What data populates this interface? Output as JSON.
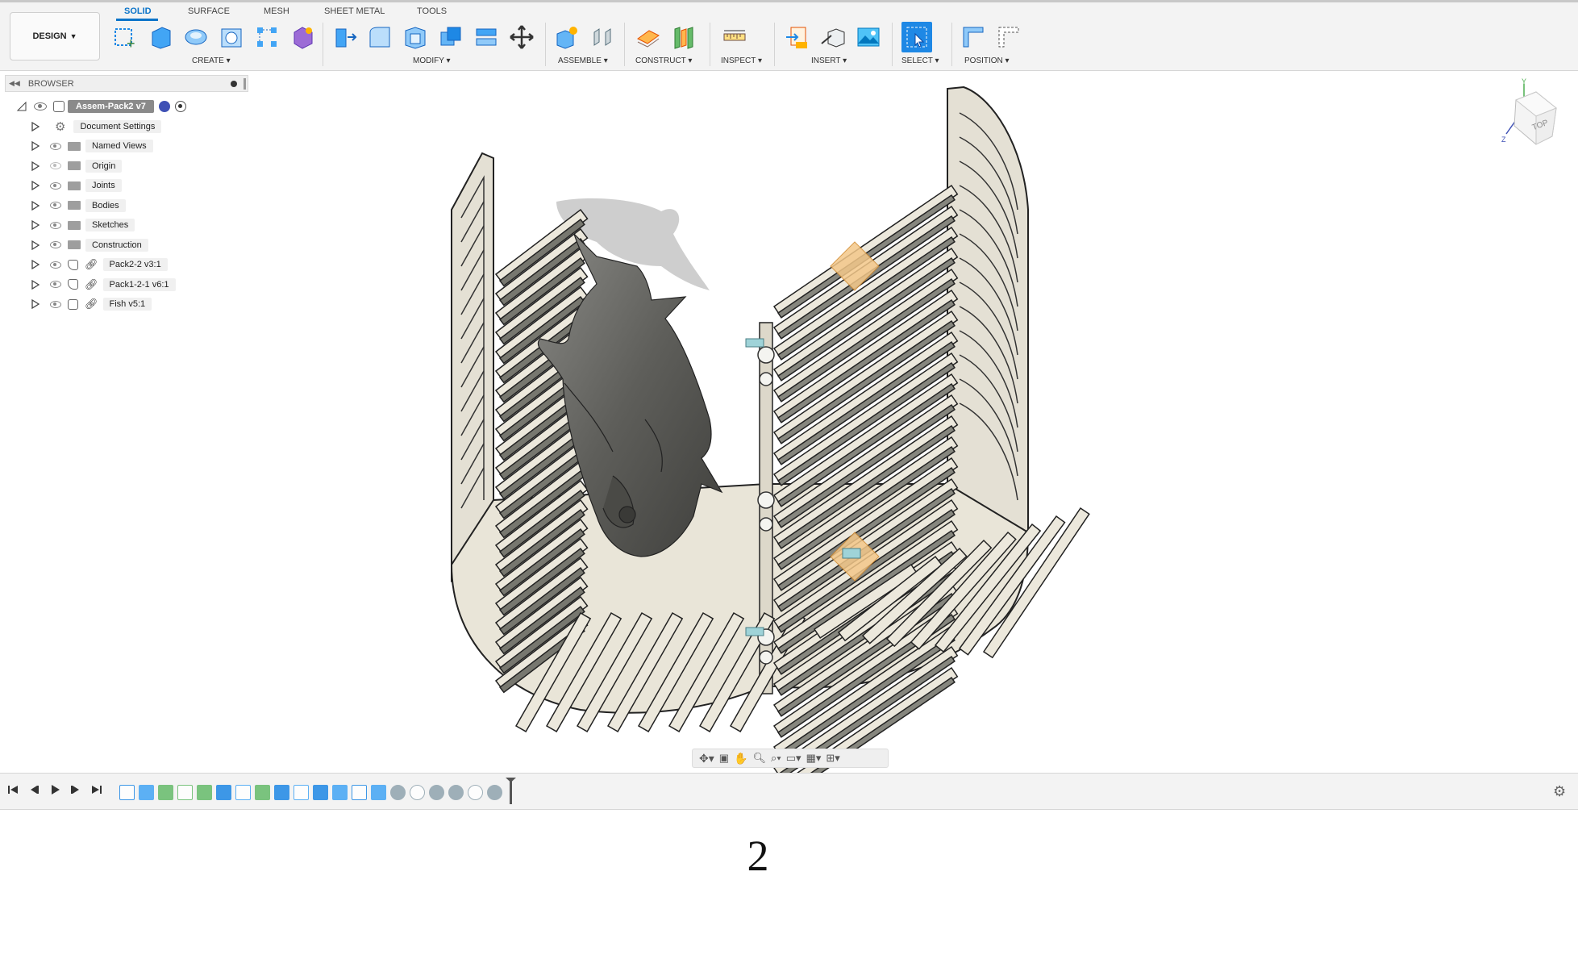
{
  "app": {
    "workspace_label": "DESIGN",
    "tabs": [
      {
        "label": "SOLID",
        "active": true
      },
      {
        "label": "SURFACE",
        "active": false
      },
      {
        "label": "MESH",
        "active": false
      },
      {
        "label": "SHEET METAL",
        "active": false
      },
      {
        "label": "TOOLS",
        "active": false
      }
    ],
    "accent_color": "#0b74c9"
  },
  "toolbar": {
    "groups": [
      {
        "label": "CREATE ▾",
        "icons": [
          "new-sketch-icon",
          "extrude-icon",
          "revolve-icon",
          "hole-icon",
          "pattern-icon",
          "create-form-icon"
        ]
      },
      {
        "label": "MODIFY ▾",
        "icons": [
          "press-pull-icon",
          "fillet-icon",
          "shell-icon",
          "combine-icon",
          "split-body-icon",
          "move-icon"
        ]
      },
      {
        "label": "ASSEMBLE ▾",
        "icons": [
          "new-component-icon",
          "joint-icon"
        ]
      },
      {
        "label": "CONSTRUCT ▾",
        "icons": [
          "offset-plane-icon",
          "midplane-icon"
        ]
      },
      {
        "label": "INSPECT ▾",
        "icons": [
          "measure-icon"
        ]
      },
      {
        "label": "INSERT ▾",
        "icons": [
          "insert-mesh-icon",
          "insert-derive-icon",
          "canvas-icon"
        ]
      },
      {
        "label": "SELECT ▾",
        "icons": [
          "select-icon"
        ]
      },
      {
        "label": "POSITION ▾",
        "icons": [
          "capture-position-icon",
          "revert-position-icon"
        ]
      }
    ]
  },
  "browser": {
    "title": "BROWSER",
    "root": {
      "label": "Assem-Pack2 v7"
    },
    "items": [
      {
        "label": "Document Settings",
        "icon": "gear-icon"
      },
      {
        "label": "Named Views",
        "icon": "folder-icon"
      },
      {
        "label": "Origin",
        "icon": "folder-icon"
      },
      {
        "label": "Joints",
        "icon": "folder-icon"
      },
      {
        "label": "Bodies",
        "icon": "folder-icon"
      },
      {
        "label": "Sketches",
        "icon": "folder-icon"
      },
      {
        "label": "Construction",
        "icon": "folder-icon"
      },
      {
        "label": "Pack2-2 v3:1",
        "icon": "component-link-icon"
      },
      {
        "label": "Pack1-2-1 v6:1",
        "icon": "component-link-icon"
      },
      {
        "label": "Fish v5:1",
        "icon": "body-link-icon"
      }
    ]
  },
  "viewcube": {
    "face_label": "TOP"
  },
  "timeline": {
    "controls": [
      "skip-to-start-icon",
      "step-back-icon",
      "play-icon",
      "step-forward-icon",
      "skip-to-end-icon"
    ]
  },
  "page": {
    "number": "2"
  }
}
